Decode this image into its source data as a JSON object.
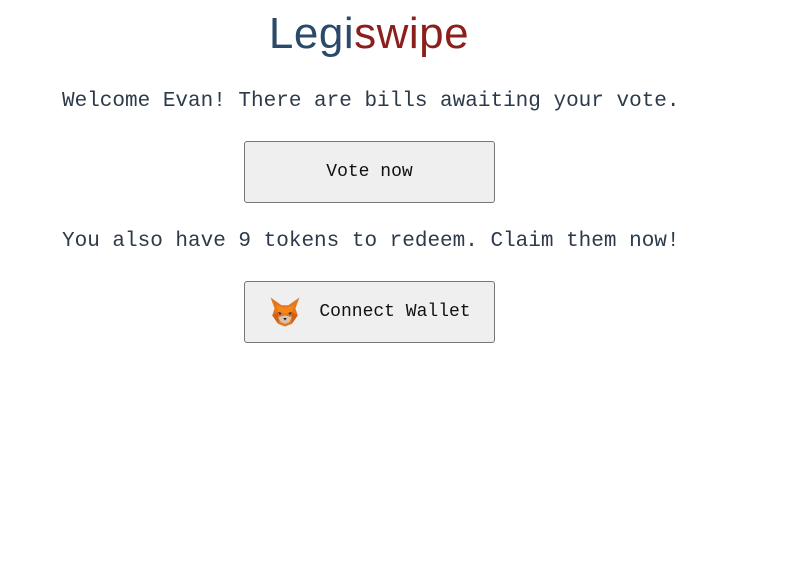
{
  "brand": {
    "part1": "Legi",
    "part2": "swipe",
    "color_part1": "#2b4a6b",
    "color_part2": "#8b1f1c"
  },
  "welcome_message": "Welcome Evan! There are bills awaiting your vote.",
  "vote_button_label": "Vote now",
  "tokens_message": "You also have 9 tokens to redeem. Claim them now!",
  "wallet_button": {
    "label": "Connect Wallet",
    "icon": "metamask-fox-icon"
  }
}
